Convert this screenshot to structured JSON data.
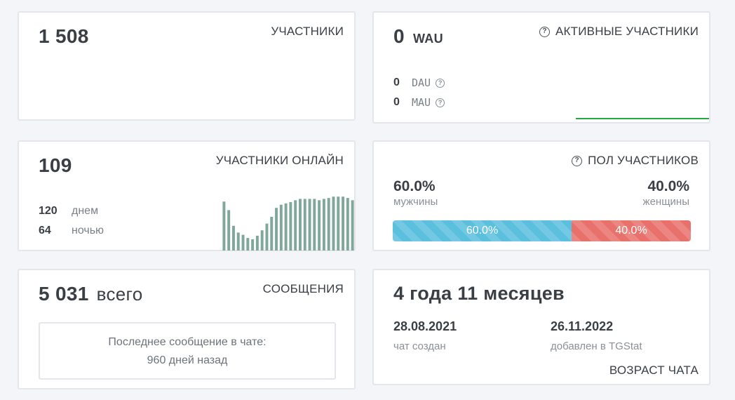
{
  "members": {
    "count": "1 508",
    "title": "УЧАСТНИКИ"
  },
  "active": {
    "wau_value": "0",
    "wau_label": "WAU",
    "title": "АКТИВНЫЕ УЧАСТНИКИ",
    "dau_value": "0",
    "dau_label": "DAU",
    "mau_value": "0",
    "mau_label": "MAU",
    "line_color": "#28a745"
  },
  "online": {
    "count": "109",
    "title": "УЧАСТНИКИ ОНЛАЙН",
    "day_value": "120",
    "day_label": "днем",
    "night_value": "64",
    "night_label": "ночью",
    "bar_color": "#7fa89a",
    "chart_data": {
      "type": "bar",
      "values": [
        109,
        90,
        55,
        40,
        35,
        28,
        25,
        33,
        45,
        60,
        75,
        95,
        102,
        105,
        108,
        112,
        115,
        115,
        115,
        115,
        112,
        115,
        117,
        120,
        120,
        120,
        117,
        112
      ],
      "ylim": [
        0,
        125
      ]
    }
  },
  "gender": {
    "title": "ПОЛ УЧАСТНИКОВ",
    "male_pct": "60.0%",
    "male_label": "мужчины",
    "female_pct": "40.0%",
    "female_label": "женщины",
    "male_fraction": 0.6,
    "female_fraction": 0.4,
    "male_color": "#5bc0de",
    "female_color": "#e8716c"
  },
  "messages": {
    "count": "5 031",
    "count_suffix": "всего",
    "title": "СООБЩЕНИЯ",
    "last_line1": "Последнее сообщение в чате:",
    "last_line2": "960 дней назад"
  },
  "age": {
    "value": "4 года 11 месяцев",
    "created_date": "28.08.2021",
    "created_label": "чат создан",
    "added_date": "26.11.2022",
    "added_label": "добавлен в TGStat",
    "title": "ВОЗРАСТ ЧАТА"
  }
}
